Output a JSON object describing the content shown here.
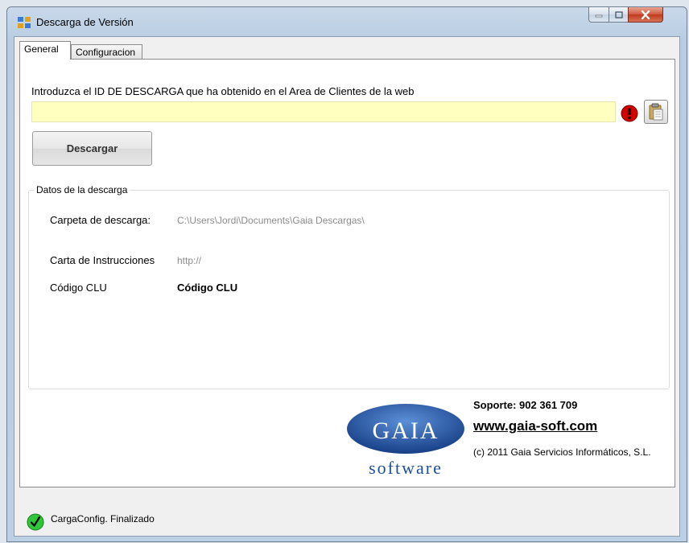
{
  "window": {
    "title": "Descarga de Versión"
  },
  "tabs": [
    {
      "label": "General",
      "active": true
    },
    {
      "label": "Configuracion",
      "active": false
    }
  ],
  "general": {
    "instruction": "Introduzca el ID DE DESCARGA que ha obtenido en el Area de Clientes de la web",
    "id_input": {
      "value": "",
      "placeholder": ""
    },
    "descargar_label": "Descargar"
  },
  "datos": {
    "legend": "Datos de la descarga",
    "carpeta_label": "Carpeta de descarga:",
    "carpeta_value": "C:\\Users\\Jordi\\Documents\\Gaia Descargas\\",
    "carta_label": "Carta de Instrucciones",
    "carta_value": "http://",
    "clu_label": "Código CLU",
    "clu_value": "Código CLU"
  },
  "branding": {
    "logo_top": "GAIA",
    "logo_bottom": "software",
    "soporte": "Soporte: 902 361 709",
    "web": "www.gaia-soft.com",
    "copyright": "(c) 2011 Gaia Servicios Informáticos, S.L."
  },
  "status": {
    "text": "CargaConfig. Finalizado"
  },
  "icons": {
    "error": "exclamation-icon",
    "paste": "clipboard-icon",
    "ok": "checkmark-icon"
  },
  "colors": {
    "input_bg": "#ffffc0",
    "error_red": "#d40000",
    "ok_green": "#2fc73a",
    "logo_blue": "#1d4f9e"
  }
}
